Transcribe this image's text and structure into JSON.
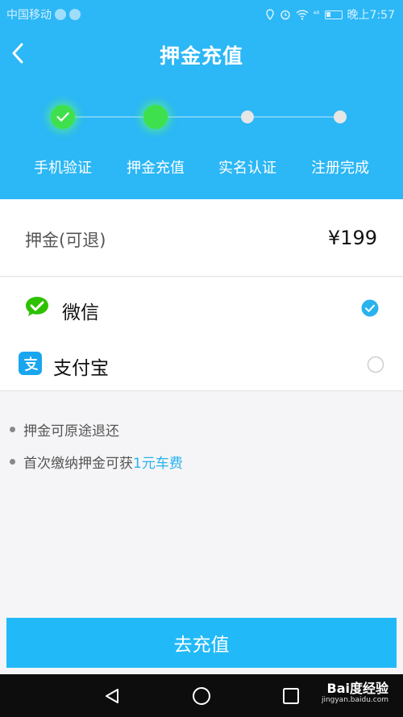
{
  "status_bar": {
    "carrier": "中国移动",
    "signal_text": "⁴⁶",
    "time": "晚上7:57"
  },
  "header": {
    "title": "押金充值"
  },
  "steps": [
    {
      "label": "手机验证",
      "state": "done"
    },
    {
      "label": "押金充值",
      "state": "current"
    },
    {
      "label": "实名认证",
      "state": "todo"
    },
    {
      "label": "注册完成",
      "state": "todo"
    }
  ],
  "deposit": {
    "label": "押金(可退)",
    "amount": "¥199"
  },
  "payment_methods": [
    {
      "name": "微信",
      "icon": "wechat-icon",
      "selected": true
    },
    {
      "name": "支付宝",
      "icon": "alipay-icon",
      "selected": false
    }
  ],
  "notes": {
    "note1": "押金可原途退还",
    "note2_prefix": "首次缴纳押金可获",
    "note2_highlight": "1元车费"
  },
  "cta": {
    "label": "去充值"
  },
  "watermark": {
    "brand": "Bai度经验",
    "url": "jingyan.baidu.com"
  },
  "colors": {
    "header_bg": "#2cb7f6",
    "step_done": "#3fe04d",
    "accent": "#29b3ee",
    "cta_bg": "#22b9f8",
    "wechat_green": "#2dc100",
    "alipay_blue": "#1aa6ef"
  }
}
